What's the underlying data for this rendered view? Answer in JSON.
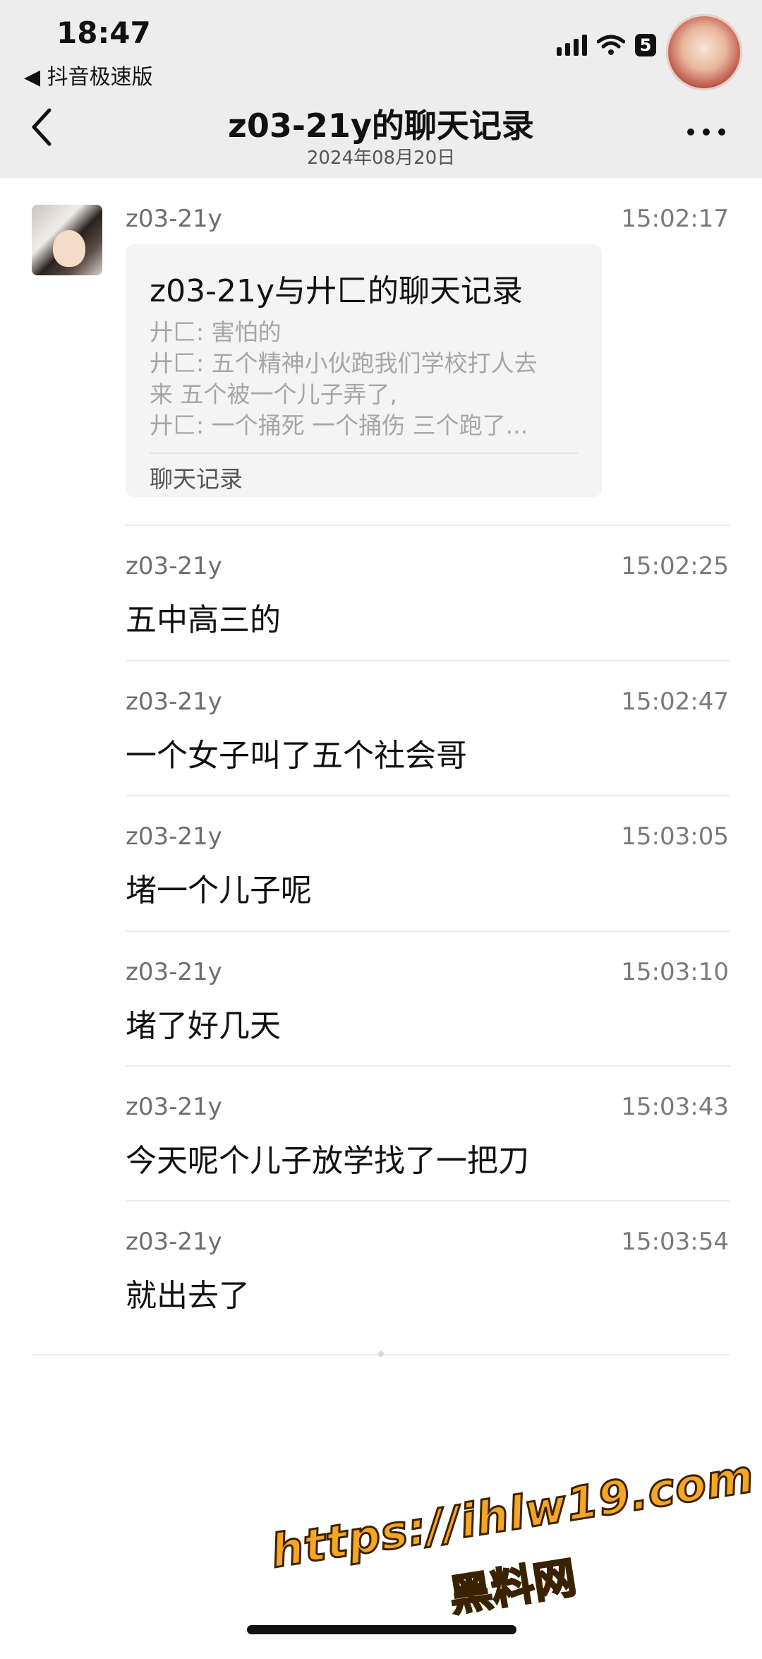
{
  "status_bar": {
    "time": "18:47",
    "back_app": "◀ 抖音极速版",
    "battery": "5"
  },
  "nav": {
    "title": "z03-21y的聊天记录",
    "date": "2024年08月20日"
  },
  "messages": [
    {
      "sender": "z03-21y",
      "time": "15:02:17",
      "card": {
        "title": "z03-21y与廾匚的聊天记录",
        "lines": [
          "廾匚: 害怕的",
          "廾匚: 五个精神小伙跑我们学校打人去",
          "来  五个被一个儿子弄了,",
          "廾匚: 一个捅死 一个捅伤    三个跑了..."
        ],
        "label": "聊天记录"
      }
    },
    {
      "sender": "z03-21y",
      "time": "15:02:25",
      "text": "五中高三的"
    },
    {
      "sender": "z03-21y",
      "time": "15:02:47",
      "text": "一个女子叫了五个社会哥"
    },
    {
      "sender": "z03-21y",
      "time": "15:03:05",
      "text": "堵一个儿子呢"
    },
    {
      "sender": "z03-21y",
      "time": "15:03:10",
      "text": "堵了好几天"
    },
    {
      "sender": "z03-21y",
      "time": "15:03:43",
      "text": "今天呢个儿子放学找了一把刀"
    },
    {
      "sender": "z03-21y",
      "time": "15:03:54",
      "text": "就出去了"
    }
  ],
  "watermark": {
    "url": "https://ihlw19.com",
    "name": "黑料网"
  },
  "colors": {
    "header_bg": "#ededed",
    "watermark": "#f5a623"
  }
}
